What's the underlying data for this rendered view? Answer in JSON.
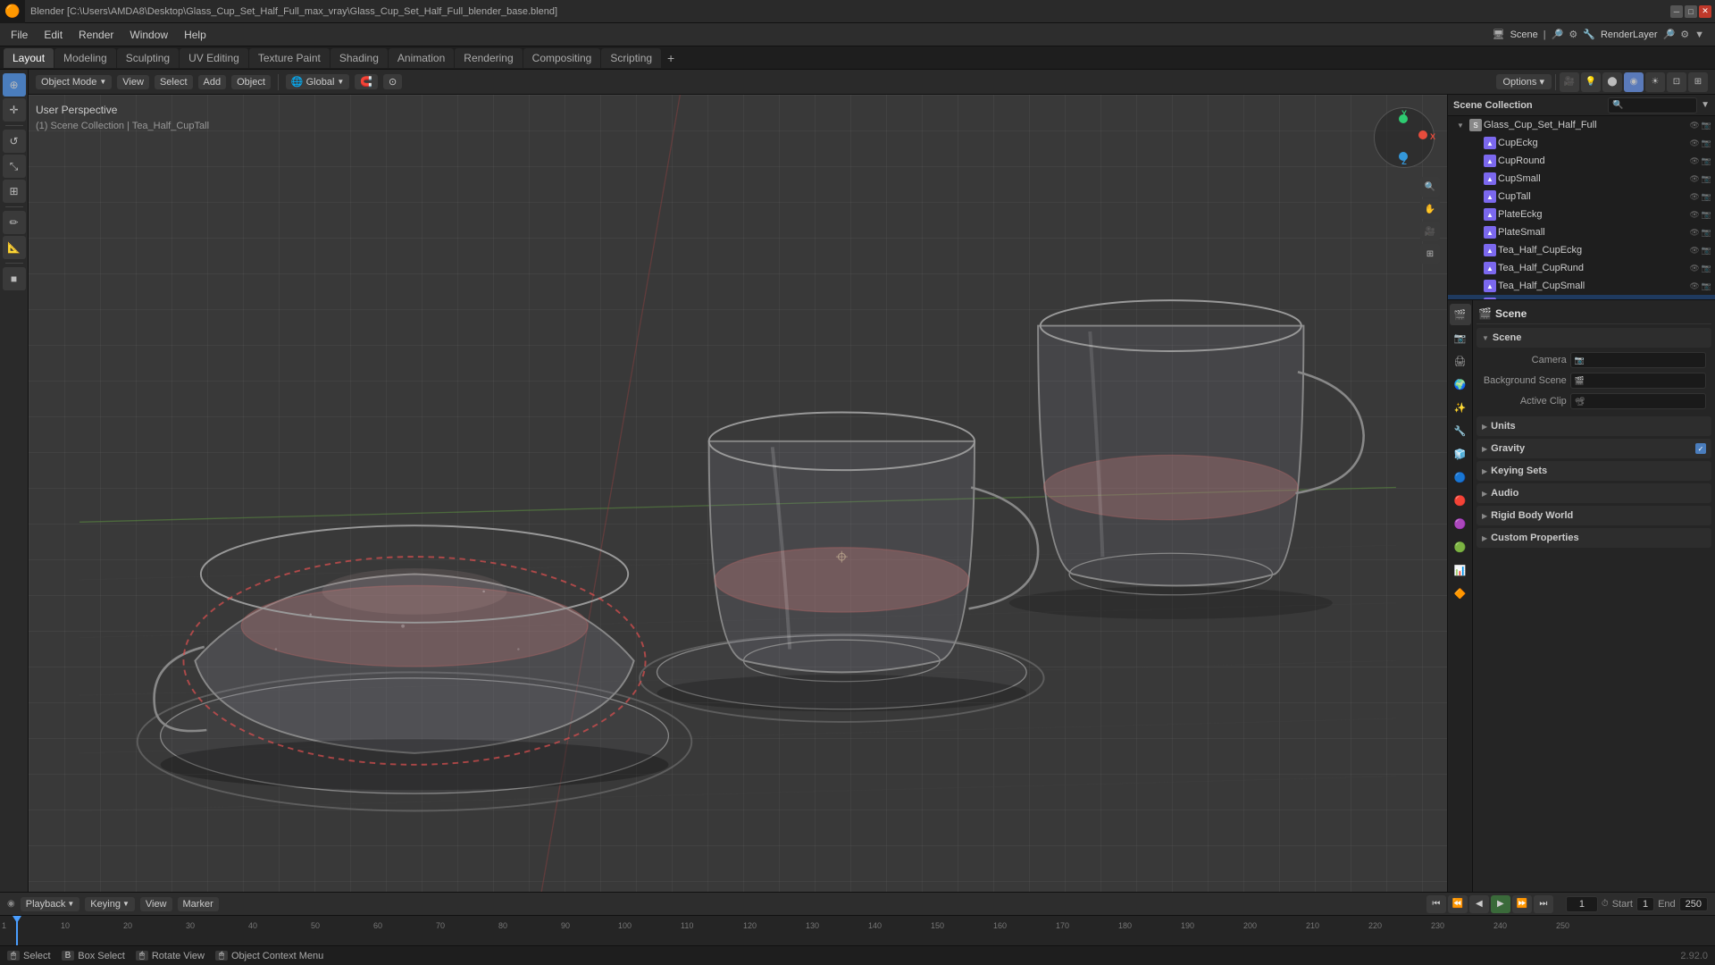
{
  "window": {
    "title": "Blender [C:\\Users\\AMDA8\\Desktop\\Glass_Cup_Set_Half_Full_max_vray\\Glass_Cup_Set_Half_Full_blender_base.blend]",
    "version": "2.92.0"
  },
  "menubar": {
    "items": [
      "Blender",
      "File",
      "Edit",
      "Render",
      "Window",
      "Help"
    ]
  },
  "workspace_tabs": {
    "tabs": [
      "Layout",
      "Modeling",
      "Sculpting",
      "UV Editing",
      "Texture Paint",
      "Shading",
      "Animation",
      "Rendering",
      "Compositing",
      "Scripting"
    ],
    "active": "Layout",
    "add_label": "+"
  },
  "viewport_header": {
    "mode": "Object Mode",
    "view_label": "View",
    "select_label": "Select",
    "add_label": "Add",
    "object_label": "Object",
    "transform": "Global",
    "options_label": "Options ▾"
  },
  "viewport_info": {
    "perspective": "User Perspective",
    "collection": "(1) Scene Collection | Tea_Half_CupTall"
  },
  "outliner": {
    "title": "Scene Collection",
    "search_placeholder": "🔍",
    "items": [
      {
        "name": "Glass_Cup_Set_Half_Full",
        "type": "scene",
        "level": 0,
        "expanded": true
      },
      {
        "name": "CupEckg",
        "type": "mesh",
        "level": 1
      },
      {
        "name": "CupRound",
        "type": "mesh",
        "level": 1
      },
      {
        "name": "CupSmall",
        "type": "mesh",
        "level": 1
      },
      {
        "name": "CupTall",
        "type": "mesh",
        "level": 1
      },
      {
        "name": "PlateEckg",
        "type": "mesh",
        "level": 1
      },
      {
        "name": "PlateSmall",
        "type": "mesh",
        "level": 1
      },
      {
        "name": "Tea_Half_CupEckg",
        "type": "mesh",
        "level": 1
      },
      {
        "name": "Tea_Half_CupRund",
        "type": "mesh",
        "level": 1
      },
      {
        "name": "Tea_Half_CupSmall",
        "type": "mesh",
        "level": 1
      },
      {
        "name": "Tea_Half_CupTall",
        "type": "mesh",
        "level": 1,
        "selected": true
      }
    ]
  },
  "properties": {
    "title": "Scene",
    "scene_name": "Scene",
    "camera_label": "Camera",
    "background_scene_label": "Background Scene",
    "active_clip_label": "Active Clip",
    "sections": [
      {
        "name": "Scene",
        "expanded": true,
        "items": [
          {
            "label": "Camera",
            "value": "",
            "icon": "📷"
          },
          {
            "label": "Background Scene",
            "value": "",
            "icon": "🎬"
          },
          {
            "label": "Active Clip",
            "value": "",
            "icon": "📽"
          }
        ]
      },
      {
        "name": "Units",
        "expanded": false
      },
      {
        "name": "Gravity",
        "expanded": false,
        "toggle": true
      },
      {
        "name": "Keying Sets",
        "expanded": false
      },
      {
        "name": "Audio",
        "expanded": false
      },
      {
        "name": "Rigid Body World",
        "expanded": false
      },
      {
        "name": "Custom Properties",
        "expanded": false
      }
    ]
  },
  "timeline": {
    "playback_label": "Playback",
    "keying_label": "Keying",
    "view_label": "View",
    "marker_label": "Marker",
    "current_frame": "1",
    "start_label": "Start",
    "start_value": "1",
    "end_label": "End",
    "end_value": "250",
    "frame_marks": [
      "1",
      "10",
      "20",
      "30",
      "40",
      "50",
      "60",
      "70",
      "80",
      "90",
      "100",
      "110",
      "120",
      "130",
      "140",
      "150",
      "160",
      "170",
      "180",
      "190",
      "200",
      "210",
      "220",
      "230",
      "240",
      "250"
    ]
  },
  "statusbar": {
    "select_label": "Select",
    "box_select_label": "Box Select",
    "rotate_view_label": "Rotate View",
    "object_context_label": "Object Context Menu",
    "version": "2.92.0"
  },
  "props_sidebar_icons": [
    "🎬",
    "📷",
    "🌍",
    "✨",
    "🔧",
    "🧊",
    "👤",
    "⬛",
    "🔴",
    "🟣",
    "🟢"
  ],
  "gizmo": {
    "x_label": "X",
    "y_label": "Y",
    "z_label": "Z"
  }
}
